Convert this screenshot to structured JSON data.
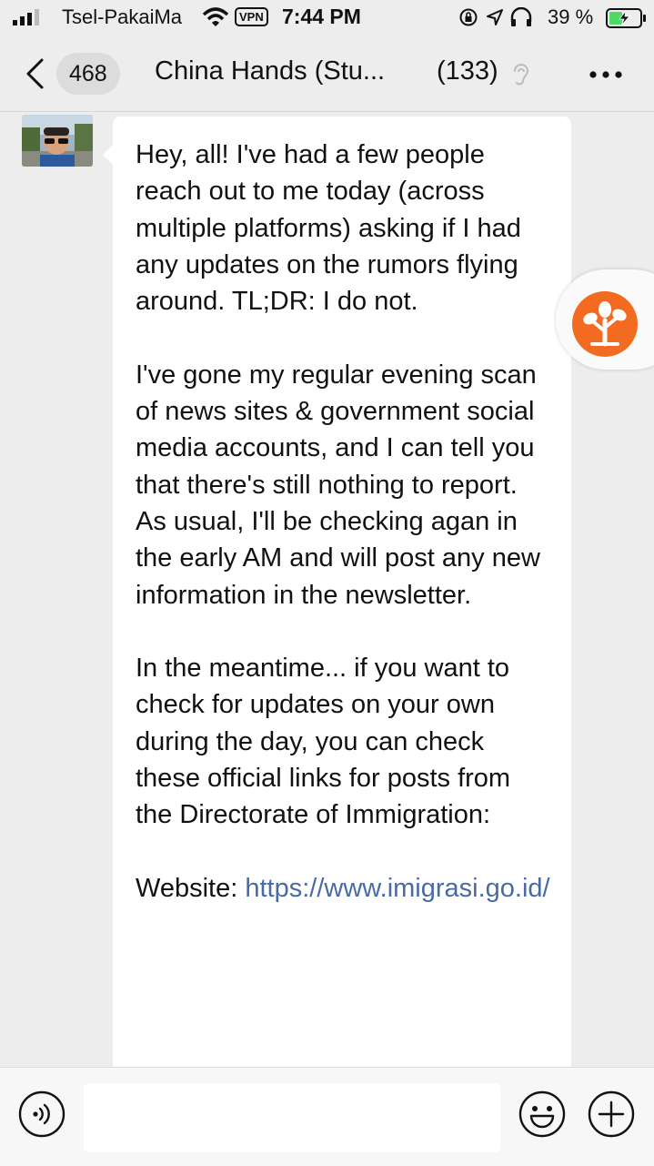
{
  "status_bar": {
    "carrier": "Tsel-PakaiMa",
    "vpn": "VPN",
    "time": "7:44 PM",
    "battery_pct": "39 %"
  },
  "nav": {
    "back_count": "468",
    "title": "China Hands (Stu...",
    "members": "(133)"
  },
  "message": {
    "paragraphs": [
      "Hey, all! I've had a few people reach out to me today (across multiple platforms) asking if I had any updates on the rumors flying around. TL;DR: I do not.",
      "I've gone my regular evening scan of news sites & government social media accounts, and I can tell you that there's still nothing to report. As usual, I'll be checking agan in the early AM and will post any new information in the newsletter.",
      "In the meantime... if you want to check for updates on your own during the day, you can check these official links for posts from the Directorate of Immigration:"
    ],
    "website_label": "Website: ",
    "website_link": "https://www.imigrasi.go.id/"
  },
  "input": {
    "value": "",
    "placeholder": ""
  },
  "colors": {
    "accent_orange": "#f26b21",
    "link_blue": "#4a6aa5",
    "background": "#ededed"
  },
  "icons": [
    "signal-icon",
    "wifi-icon",
    "lock-rotation-icon",
    "location-icon",
    "headphones-icon",
    "battery-charging-icon",
    "back-chevron-icon",
    "mute-ear-icon",
    "more-icon",
    "tree-icon",
    "voice-icon",
    "emoji-icon",
    "plus-icon"
  ]
}
